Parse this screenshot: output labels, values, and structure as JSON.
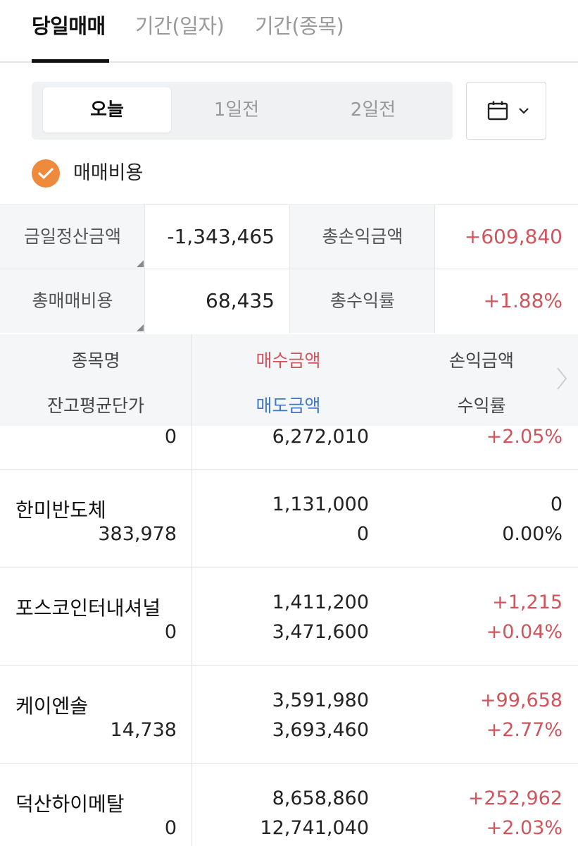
{
  "tabs": [
    {
      "label": "당일매매",
      "active": true
    },
    {
      "label": "기간(일자)",
      "active": false
    },
    {
      "label": "기간(종목)",
      "active": false
    }
  ],
  "segment": {
    "items": [
      "오늘",
      "1일전",
      "2일전"
    ],
    "selected": "오늘"
  },
  "calendar": {
    "icon": "calendar-icon"
  },
  "checkbox": {
    "label": "매매비용",
    "checked": true
  },
  "summary": {
    "settle_label": "금일정산금액",
    "settle_value": "-1,343,465",
    "total_pl_label": "총손익금액",
    "total_pl_value": "+609,840",
    "total_fee_label": "총매매비용",
    "total_fee_value": "68,435",
    "total_rate_label": "총수익률",
    "total_rate_value": "+1.88%"
  },
  "table_header": {
    "name": "종목명",
    "buy": "매수금액",
    "pl": "손익금액",
    "avg": "잔고평균단가",
    "sell": "매도금액",
    "rate": "수익률"
  },
  "rows": [
    {
      "name": "",
      "avg": "0",
      "buy": "",
      "sell": "6,272,010",
      "pl": "",
      "rate": "+2.05%"
    },
    {
      "name": "한미반도체",
      "avg": "383,978",
      "buy": "1,131,000",
      "sell": "0",
      "pl": "0",
      "rate": "0.00%"
    },
    {
      "name": "포스코인터내셔널",
      "avg": "0",
      "buy": "1,411,200",
      "sell": "3,471,600",
      "pl": "+1,215",
      "rate": "+0.04%"
    },
    {
      "name": "케이엔솔",
      "avg": "14,738",
      "buy": "3,591,980",
      "sell": "3,693,460",
      "pl": "+99,658",
      "rate": "+2.77%"
    },
    {
      "name": "덕산하이메탈",
      "avg": "0",
      "buy": "8,658,860",
      "sell": "12,741,040",
      "pl": "+252,962",
      "rate": "+2.03%"
    }
  ],
  "colors": {
    "positive": "#d0545b",
    "sell_header": "#3e78c7",
    "check": "#ee8a3b"
  }
}
